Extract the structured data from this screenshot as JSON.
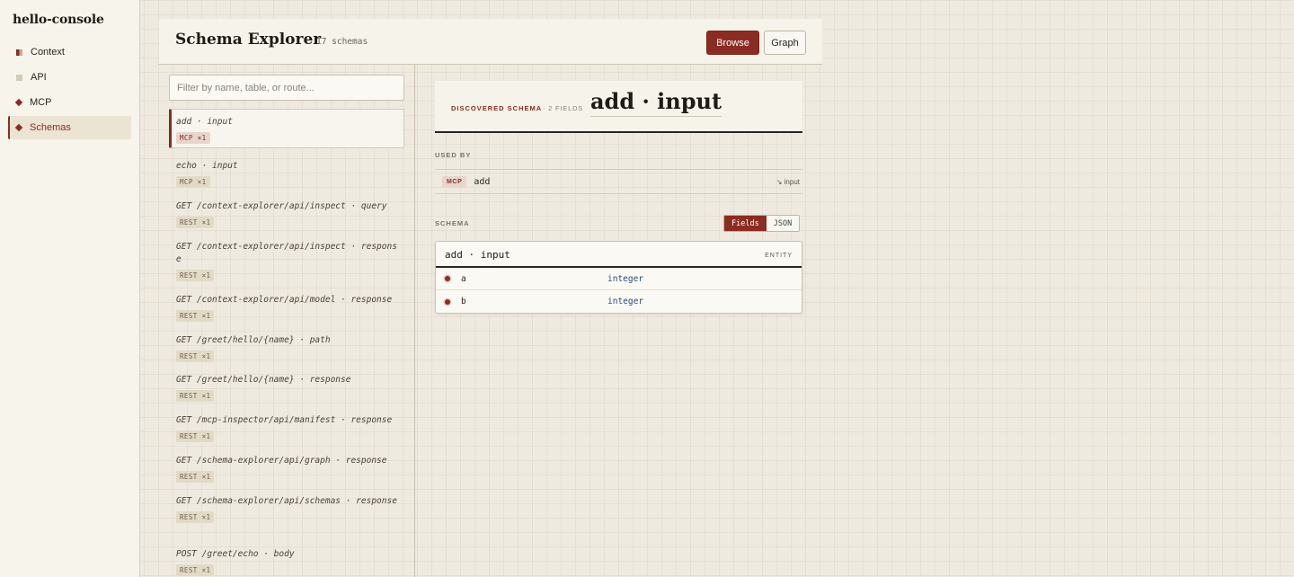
{
  "sidebar": {
    "brand": "hello-console",
    "items": [
      {
        "label": "Context",
        "icon": "context-icon"
      },
      {
        "label": "API",
        "icon": "api-icon"
      },
      {
        "label": "MCP",
        "icon": "diamond-icon"
      },
      {
        "label": "Schemas",
        "icon": "diamond-icon",
        "active": true
      }
    ]
  },
  "header": {
    "title": "Schema Explorer",
    "count": "17 schemas",
    "browse_label": "Browse",
    "graph_label": "Graph"
  },
  "filter": {
    "placeholder": "Filter by name, table, or route..."
  },
  "schemas": [
    {
      "name": "add · input",
      "tag": "MCP ×1"
    },
    {
      "name": "echo · input",
      "tag": "MCP ×1"
    },
    {
      "name": "GET /context-explorer/api/inspect · query",
      "tag": "REST ×1"
    },
    {
      "name": "GET /context-explorer/api/inspect · response",
      "tag": "REST ×1"
    },
    {
      "name": "GET /context-explorer/api/model · response",
      "tag": "REST ×1"
    },
    {
      "name": "GET /greet/hello/{name} · path",
      "tag": "REST ×1"
    },
    {
      "name": "GET /greet/hello/{name} · response",
      "tag": "REST ×1"
    },
    {
      "name": "GET /mcp-inspector/api/manifest · response",
      "tag": "REST ×1"
    },
    {
      "name": "GET /schema-explorer/api/graph · response",
      "tag": "REST ×1"
    },
    {
      "name": "GET /schema-explorer/api/schemas · response",
      "tag": "REST ×1"
    },
    {
      "name": "POST /greet/echo · body",
      "tag": "REST ×1"
    }
  ],
  "detail": {
    "kicker": "DISCOVERED SCHEMA",
    "field_count": "· 2 FIELDS",
    "title": "add · input",
    "used_by_label": "USED BY",
    "used_by": {
      "tag": "MCP",
      "name": "add",
      "relation": "↘ input"
    },
    "schema_label": "SCHEMA",
    "toggle": {
      "fields": "Fields",
      "json": "JSON"
    },
    "entity": {
      "name": "add · input",
      "kind": "ENTITY",
      "fields": [
        {
          "name": "a",
          "type": "integer"
        },
        {
          "name": "b",
          "type": "integer"
        }
      ]
    }
  },
  "colors": {
    "accent": "#8b2c22",
    "type_color": "#2d4a7a",
    "background": "#efeadf"
  }
}
